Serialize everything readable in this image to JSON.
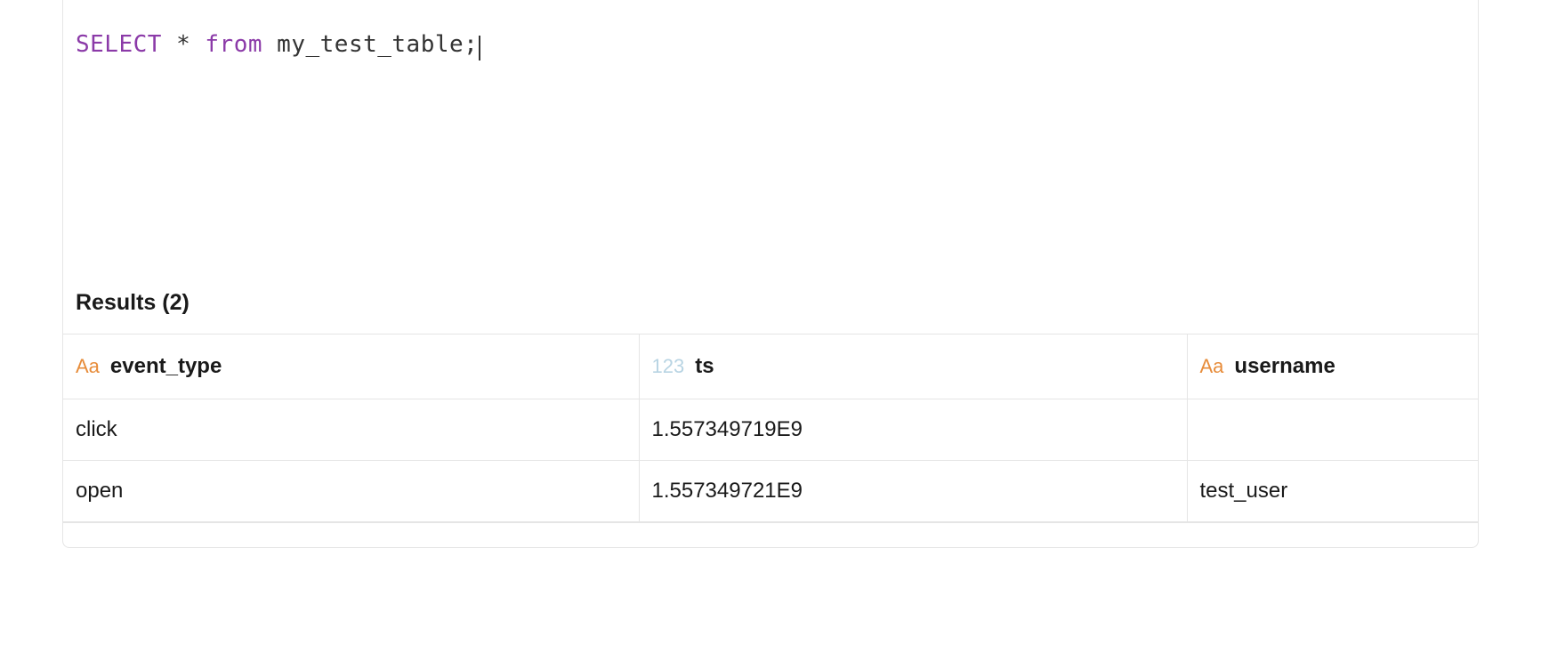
{
  "editor": {
    "tokens": {
      "select": "SELECT",
      "star": "*",
      "from": "from",
      "table": "my_test_table",
      "semi": ";"
    }
  },
  "results": {
    "header": "Results (2)",
    "columns": [
      {
        "type_icon": "Aa",
        "type_class": "string",
        "name": "event_type"
      },
      {
        "type_icon": "123",
        "type_class": "number",
        "name": "ts"
      },
      {
        "type_icon": "Aa",
        "type_class": "string",
        "name": "username"
      }
    ],
    "rows": [
      {
        "event_type": "click",
        "ts": "1.557349719E9",
        "username": ""
      },
      {
        "event_type": "open",
        "ts": "1.557349721E9",
        "username": "test_user"
      }
    ]
  }
}
